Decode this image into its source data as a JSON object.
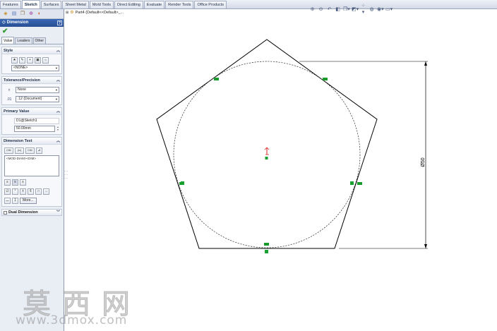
{
  "tabs": [
    "Features",
    "Sketch",
    "Surfaces",
    "Sheet Metal",
    "Mold Tools",
    "Direct Editing",
    "Evaluate",
    "Render Tools",
    "Office Products"
  ],
  "active_tab": "Sketch",
  "panel": {
    "title": "Dimension",
    "help": "?",
    "subtabs": [
      "Value",
      "Leaders",
      "Other"
    ],
    "style": {
      "header": "Style",
      "combo": "<NONE>"
    },
    "tolerance": {
      "header": "Tolerance/Precision",
      "tolerance_type": "None",
      "precision": ".12 (Document)"
    },
    "primary_value": {
      "header": "Primary Value",
      "name": "D1@Sketch1",
      "value": "50.00mm"
    },
    "dimension_text": {
      "header": "Dimension Text",
      "buttons": [
        "DIM",
        "(xx)",
        "DIM"
      ],
      "text": "<MOD-DIAM><DIM>",
      "more_label": "More..."
    },
    "dual_dimension": "Dual Dimension"
  },
  "tree": {
    "part_label": "Part4  (Default<<Default>_..."
  },
  "drawing": {
    "dimension_label": "Ø50"
  },
  "watermark": {
    "chinese": "莫西网",
    "url": "www.3dmox.com"
  },
  "icons": {
    "ok": "✔",
    "view_toolbar": [
      "zoom-to-fit-icon",
      "zoom-area-icon",
      "previous-view-icon",
      "section-view-icon",
      "view-orientation-icon",
      "display-style-icon",
      "hide-show-icon",
      "edit-appearance-icon",
      "scene-icon",
      "view-settings-icon"
    ]
  }
}
